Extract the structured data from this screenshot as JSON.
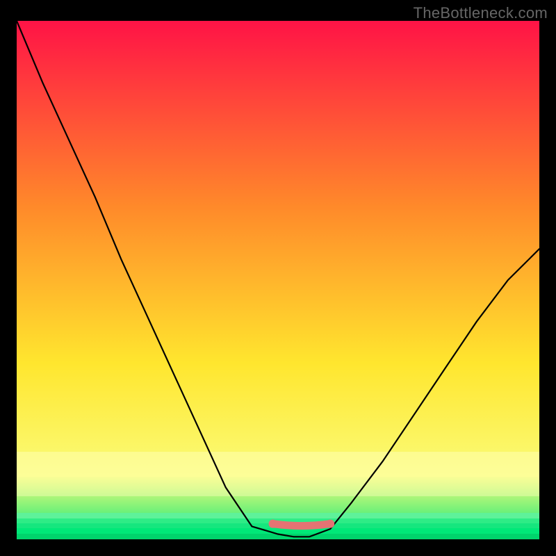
{
  "watermark": "TheBottleneck.com",
  "chart_data": {
    "type": "line",
    "title": "",
    "xlabel": "",
    "ylabel": "",
    "x_normalized": [
      0.0,
      0.05,
      0.1,
      0.15,
      0.2,
      0.25,
      0.3,
      0.35,
      0.4,
      0.45,
      0.5,
      0.53,
      0.56,
      0.6,
      0.64,
      0.7,
      0.76,
      0.82,
      0.88,
      0.94,
      1.0
    ],
    "y_normalized": [
      1.0,
      0.88,
      0.77,
      0.66,
      0.54,
      0.43,
      0.32,
      0.21,
      0.1,
      0.025,
      0.01,
      0.005,
      0.005,
      0.02,
      0.07,
      0.15,
      0.24,
      0.33,
      0.42,
      0.5,
      0.56
    ],
    "flat_segment": {
      "x_start": 0.49,
      "x_end": 0.6,
      "y": 0.03
    },
    "xlim": [
      0,
      1
    ],
    "ylim": [
      0,
      1
    ],
    "background_gradient": {
      "top": "#ff1346",
      "mid1": "#ff8a2a",
      "mid2": "#ffe62e",
      "mid3": "#fafc7a",
      "bottom": "#00e878"
    },
    "curve_color": "#000000",
    "highlight_color": "#e57373"
  }
}
